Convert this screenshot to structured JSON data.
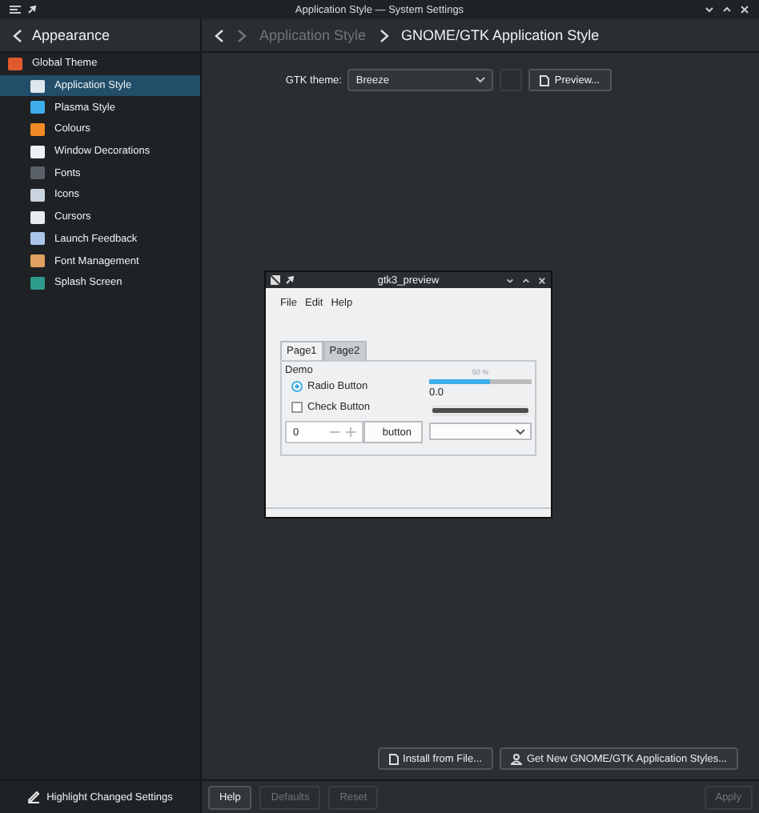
{
  "window": {
    "title": "Application Style — System Settings"
  },
  "sidebar": {
    "back_label": "Appearance",
    "items": [
      {
        "label": "Global Theme",
        "selected": false,
        "color": "#e05a2b"
      },
      {
        "label": "Application Style",
        "selected": true,
        "color": "#dfe6ee"
      },
      {
        "label": "Plasma Style",
        "selected": false,
        "color": "#3daee9"
      },
      {
        "label": "Colours",
        "selected": false,
        "color": "#f08a24"
      },
      {
        "label": "Window Decorations",
        "selected": false,
        "color": "#eef1f4"
      },
      {
        "label": "Fonts",
        "selected": false,
        "color": "#5a6068"
      },
      {
        "label": "Icons",
        "selected": false,
        "color": "#c9d4de"
      },
      {
        "label": "Cursors",
        "selected": false,
        "color": "#e8ecef"
      },
      {
        "label": "Launch Feedback",
        "selected": false,
        "color": "#a9c6e8"
      },
      {
        "label": "Font Management",
        "selected": false,
        "color": "#e0a060"
      },
      {
        "label": "Splash Screen",
        "selected": false,
        "color": "#2e9c8c"
      }
    ],
    "highlight_button": "Highlight Changed Settings"
  },
  "breadcrumb": [
    "Application Style",
    "GNOME/GTK Application Style"
  ],
  "gtk_theme": {
    "label": "GTK theme:",
    "value": "Breeze",
    "preview_button": "Preview..."
  },
  "preview_window": {
    "title": "gtk3_preview",
    "menu": [
      "File",
      "Edit",
      "Help"
    ],
    "tabs": [
      {
        "label": "Page1",
        "selected": true
      },
      {
        "label": "Page2",
        "selected": false
      }
    ],
    "group": "Demo",
    "radio": {
      "label": "Radio Button",
      "checked": true
    },
    "check": {
      "label": "Check Button",
      "checked": false
    },
    "spin_value": "0",
    "button": "button",
    "progress": {
      "label": "50 %",
      "level": 0.6
    },
    "scale": {
      "value": "0.0",
      "level": 1
    }
  },
  "actions": [
    {
      "label": "Install from File..."
    },
    {
      "label": "Get New GNOME/GTK Application Styles..."
    }
  ],
  "footer": [
    {
      "label": "Help",
      "disabled": false
    },
    {
      "label": "Defaults",
      "disabled": true
    },
    {
      "label": "Reset",
      "disabled": true
    }
  ],
  "apply": {
    "label": "Apply",
    "disabled": true
  }
}
